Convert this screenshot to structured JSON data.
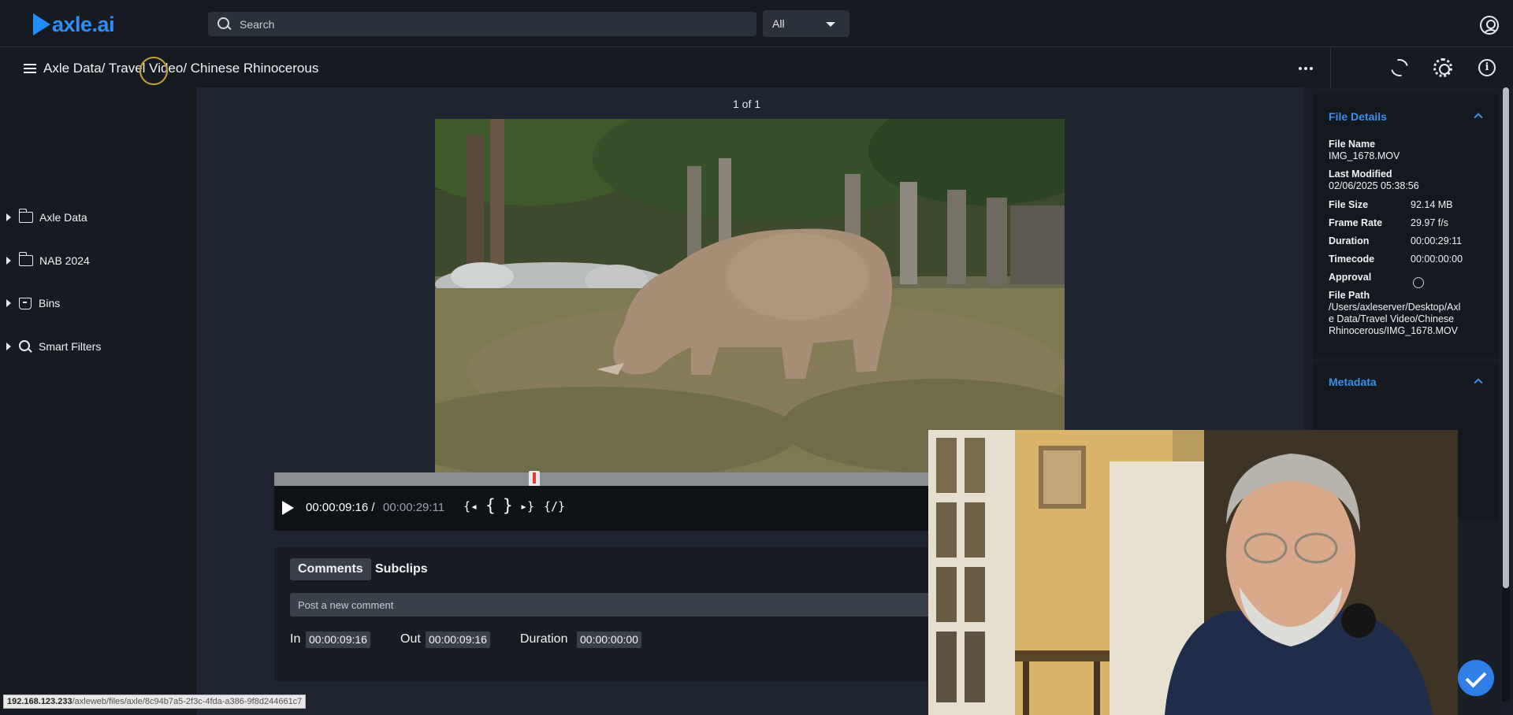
{
  "app": {
    "logo_text": "axle.ai",
    "accent_color": "#2f8ef6"
  },
  "search": {
    "placeholder": "Search",
    "scope_selected": "All"
  },
  "header": {
    "breadcrumb": "Axle Data/ Travel Video/ Chinese Rhinocerous",
    "icons": [
      "menu-icon",
      "more-horizontal-icon",
      "refresh-icon",
      "gear-icon",
      "info-icon",
      "user-icon"
    ]
  },
  "sidebar": {
    "items": [
      {
        "label": "Axle Data",
        "icon": "folder-icon"
      },
      {
        "label": "NAB 2024",
        "icon": "folder-icon"
      },
      {
        "label": "Bins",
        "icon": "bin-icon"
      },
      {
        "label": "Smart Filters",
        "icon": "search-icon"
      }
    ]
  },
  "viewer": {
    "page_count": "1 of 1",
    "playhead_progress": 0.33,
    "time_current": "00:00:09:16",
    "time_separator": " / ",
    "time_total": "00:00:29:11",
    "mark_buttons": [
      "{◂",
      "{",
      "}",
      "▸}",
      "{/}"
    ]
  },
  "comments": {
    "tabs": [
      {
        "label": "Comments",
        "active": true
      },
      {
        "label": "Subclips",
        "active": false
      }
    ],
    "input_placeholder": "Post a new comment",
    "in_label": "In",
    "in_value": "00:00:09:16",
    "out_label": "Out",
    "out_value": "00:00:09:16",
    "duration_label": "Duration",
    "duration_value": "00:00:00:00"
  },
  "status_bar": {
    "host": "192.168.123.233",
    "path": "/axleweb/files/axle/8c94b7a5-2f3c-4fda-a386-9f8d244661c7"
  },
  "file_details": {
    "title": "File Details",
    "file_name_label": "File Name",
    "file_name": "IMG_1678.MOV",
    "last_modified_label": "Last Modified",
    "last_modified": "02/06/2025 05:38:56",
    "file_size_label": "File Size",
    "file_size": "92.14 MB",
    "frame_rate_label": "Frame Rate",
    "frame_rate": "29.97 f/s",
    "duration_label": "Duration",
    "duration": "00:00:29:11",
    "timecode_label": "Timecode",
    "timecode": "00:00:00:00",
    "approval_label": "Approval",
    "file_path_label": "File Path",
    "file_path_1": "/Users/axleserver/Desktop/Axl",
    "file_path_2": "e Data/Travel Video/Chinese",
    "file_path_3": "Rhinocerous/IMG_1678.MOV"
  },
  "metadata": {
    "title": "Metadata"
  }
}
